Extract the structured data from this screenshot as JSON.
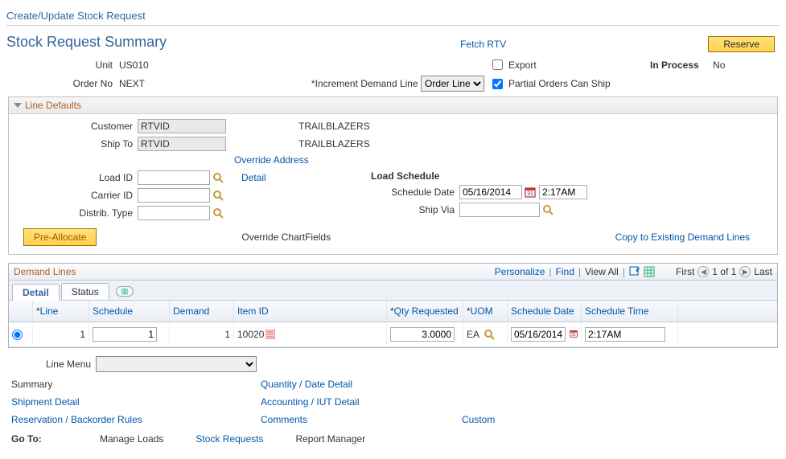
{
  "page_title": "Create/Update Stock Request",
  "section_title": "Stock Request Summary",
  "fetch_rtv": "Fetch RTV",
  "reserve": "Reserve",
  "unit_label": "Unit",
  "unit_value": "US010",
  "order_no_label": "Order No",
  "order_no_value": "NEXT",
  "increment_label": "*Increment Demand Line",
  "increment_value": "Order Line",
  "export_label": "Export",
  "partial_label": "Partial Orders Can Ship",
  "in_process_label": "In Process",
  "in_process_value": "No",
  "line_defaults_title": "Line Defaults",
  "ld": {
    "customer_label": "Customer",
    "customer_value": "RTVID",
    "customer_desc": "TRAILBLAZERS",
    "shipto_label": "Ship To",
    "shipto_value": "RTVID",
    "shipto_desc": "TRAILBLAZERS",
    "override_address": "Override Address",
    "loadid_label": "Load ID",
    "detail_link": "Detail",
    "carrier_label": "Carrier ID",
    "distrib_label": "Distrib. Type",
    "load_schedule": "Load Schedule",
    "schedule_date_label": "Schedule Date",
    "schedule_date_value": "05/16/2014",
    "schedule_time_value": "2:17AM",
    "shipvia_label": "Ship Via",
    "pre_allocate": "Pre-Allocate",
    "override_cf": "Override ChartFields",
    "copy_link": "Copy to Existing Demand Lines"
  },
  "grid": {
    "title": "Demand Lines",
    "personalize": "Personalize",
    "find": "Find",
    "view_all": "View All",
    "first": "First",
    "pager": "1 of 1",
    "last": "Last",
    "tab_detail": "Detail",
    "tab_status": "Status",
    "col_line": "Line",
    "col_schedule": "Schedule",
    "col_demand": "Demand",
    "col_itemid": "Item ID",
    "col_qty": "Qty Requested",
    "col_uom": "UOM",
    "col_sched_date": "Schedule Date",
    "col_sched_time": "Schedule Time",
    "row": {
      "line": "1",
      "schedule": "1",
      "demand": "1",
      "item_id": "10020",
      "qty": "3.0000",
      "uom": "EA",
      "sched_date": "05/16/2014",
      "sched_time": "2:17AM"
    }
  },
  "line_menu_label": "Line Menu",
  "links": {
    "summary": "Summary",
    "qty_date": "Quantity / Date Detail",
    "ship_detail": "Shipment Detail",
    "acct_iut": "Accounting / IUT Detail",
    "res_back": "Reservation / Backorder Rules",
    "comments": "Comments",
    "custom": "Custom"
  },
  "goto": {
    "label": "Go To:",
    "manage_loads": "Manage Loads",
    "stock_requests": "Stock Requests",
    "report_manager": "Report Manager"
  }
}
